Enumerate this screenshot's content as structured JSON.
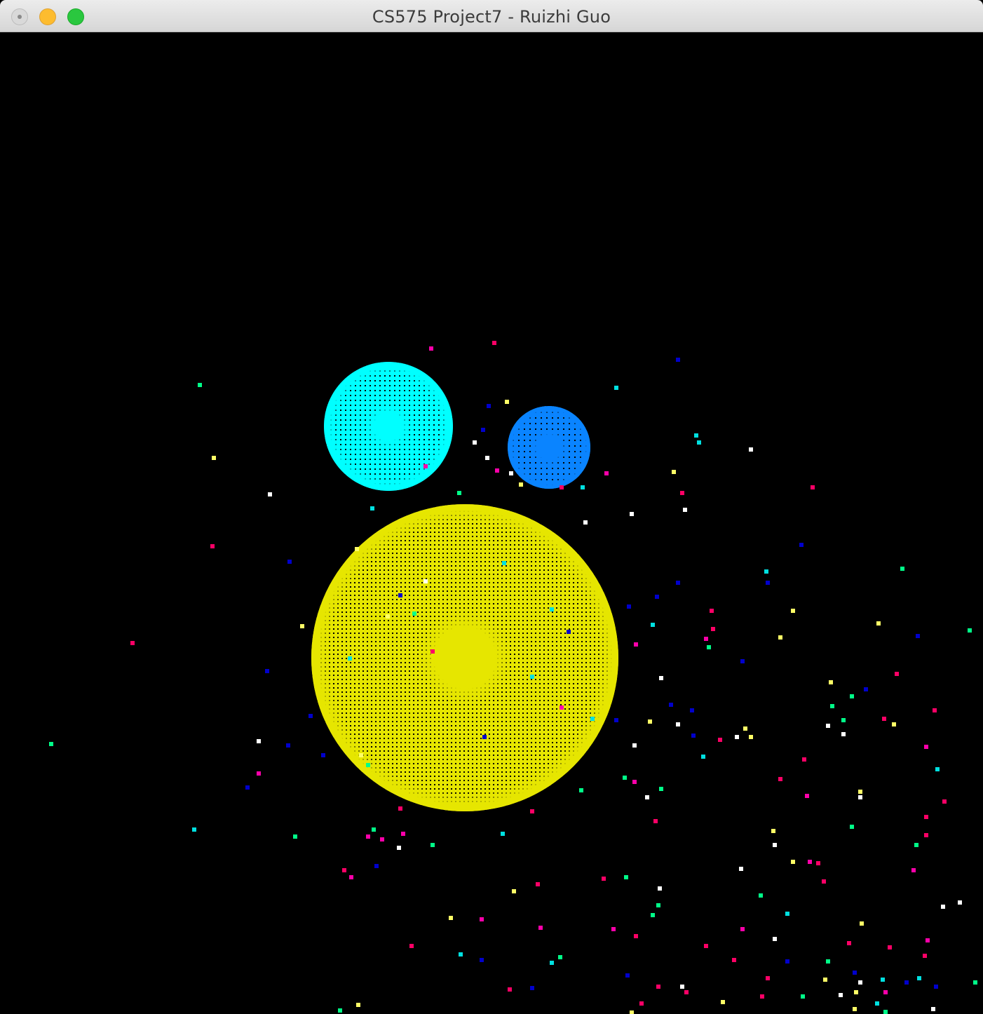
{
  "window": {
    "title": "CS575 Project7 - Ruizhi Guo"
  },
  "scene": {
    "background": "#000000",
    "spheres": [
      {
        "name": "sphere-yellow",
        "color": "#e6e600"
      },
      {
        "name": "sphere-cyan",
        "color": "#00ffff"
      },
      {
        "name": "sphere-blue",
        "color": "#0a84ff"
      }
    ],
    "particle_colors": [
      "#ff00aa",
      "#00ff88",
      "#0000cc",
      "#ffff66",
      "#ffffff",
      "#00e0e0",
      "#ff0066"
    ]
  }
}
